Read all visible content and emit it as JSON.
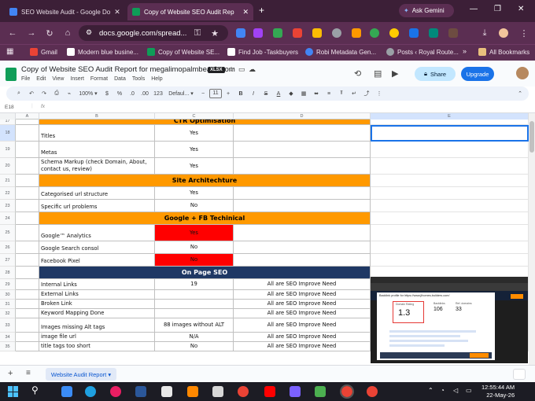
{
  "browser": {
    "tabs": [
      {
        "title": "SEO Website Audit - Google Do",
        "active": false
      },
      {
        "title": "Copy of Website SEO Audit Rep",
        "active": true
      }
    ],
    "new_tab_label": "+",
    "ask_gemini": "Ask Gemini",
    "url": "docs.google.com/spread...",
    "bookmarks": [
      "Gmail",
      "Modern blue busine...",
      "Copy of Website SE...",
      "Find Job -Taskbuyers",
      "Robi Metadata Gen...",
      "Posts ‹ Royal Route..."
    ],
    "colors": {
      "frame": "#3c1f37",
      "toolbar": "#5b2e52"
    }
  },
  "sheets": {
    "doc_title": "Copy of Website SEO Audit Report for megalimopalmbeach.com",
    "badge": "XLSX",
    "menus": [
      "File",
      "Edit",
      "View",
      "Insert",
      "Format",
      "Data",
      "Tools",
      "Help"
    ],
    "share_label": "Share",
    "upgrade_label": "Upgrade",
    "zoom": "100%",
    "currency_symbol": "$",
    "percent_symbol": "%",
    "decimal_less": ".0",
    "decimal_more": ".00",
    "number_format": "123",
    "font_name": "Defaul...",
    "font_size": "11",
    "bold_label": "B",
    "italic_label": "I",
    "strike_label": "S",
    "text_color_label": "A",
    "cell_ref": "E18",
    "fx_label": "fx",
    "columns": [
      "A",
      "B",
      "C",
      "D",
      "E"
    ],
    "active_sheet": "Website Audit Report"
  },
  "grid": {
    "rows": [
      {
        "num": "17",
        "type": "section",
        "title": "CTR Optimisation"
      },
      {
        "num": "18",
        "b": "Titles",
        "c": "Yes",
        "d": ""
      },
      {
        "num": "19",
        "b": "Metas",
        "c": "Yes",
        "d": ""
      },
      {
        "num": "20",
        "b": "Schema Markup (check Domain, About, contact us, review)",
        "c": "Yes",
        "d": ""
      },
      {
        "num": "21",
        "type": "section",
        "title": "Site Architechture"
      },
      {
        "num": "22",
        "b": "Categorised url structure",
        "c": "Yes",
        "d": ""
      },
      {
        "num": "23",
        "b": "Specific url problems",
        "c": "No",
        "d": ""
      },
      {
        "num": "24",
        "type": "section",
        "title": "Google + FB Techinical"
      },
      {
        "num": "25",
        "b": "Google™ Analytics",
        "c": "Yes",
        "d": "",
        "c_color": "#ff0000"
      },
      {
        "num": "26",
        "b": "Google Search consol",
        "c": "No",
        "d": ""
      },
      {
        "num": "27",
        "b": "Facebook Pixel",
        "c": "No",
        "d": "",
        "c_color": "#ff0000"
      },
      {
        "num": "28",
        "type": "navy",
        "title": "On Page SEO"
      },
      {
        "num": "29",
        "b": "Internal Links",
        "c": "19",
        "d": "All are SEO Improve Need"
      },
      {
        "num": "30",
        "b": "External Links",
        "c": "",
        "d": "All are SEO Improve Need"
      },
      {
        "num": "31",
        "b": "Broken Link",
        "c": "",
        "d": "All are SEO Improve Need"
      },
      {
        "num": "32",
        "b": "Keyword Mapping Done",
        "c": "",
        "d": "All are SEO Improve Need"
      },
      {
        "num": "33",
        "b": "Images missing Alt tags",
        "c": "88 images without ALT",
        "d": "All are SEO Improve Need"
      },
      {
        "num": "34",
        "b": "image file url",
        "c": "N/A",
        "d": "All are SEO Improve Need"
      },
      {
        "num": "35",
        "b": "title tags too short",
        "c": "No",
        "d": "All are SEO Improve Need"
      }
    ],
    "colors": {
      "section": "#ff9900",
      "navy": "#1f3864",
      "red": "#ff0000"
    }
  },
  "embedded_image": {
    "heading": "Backlink profile for https://www.jlhomes-builders.com/",
    "domain_rating_label": "Domain Rating",
    "domain_rating": "1.3",
    "backlinks_label": "Backlinks",
    "backlinks": "106",
    "ref_domains_label": "Ref. domains",
    "ref_domains": "33"
  },
  "taskbar": {
    "time": "12:55:44 AM",
    "date": "22-May-26"
  }
}
